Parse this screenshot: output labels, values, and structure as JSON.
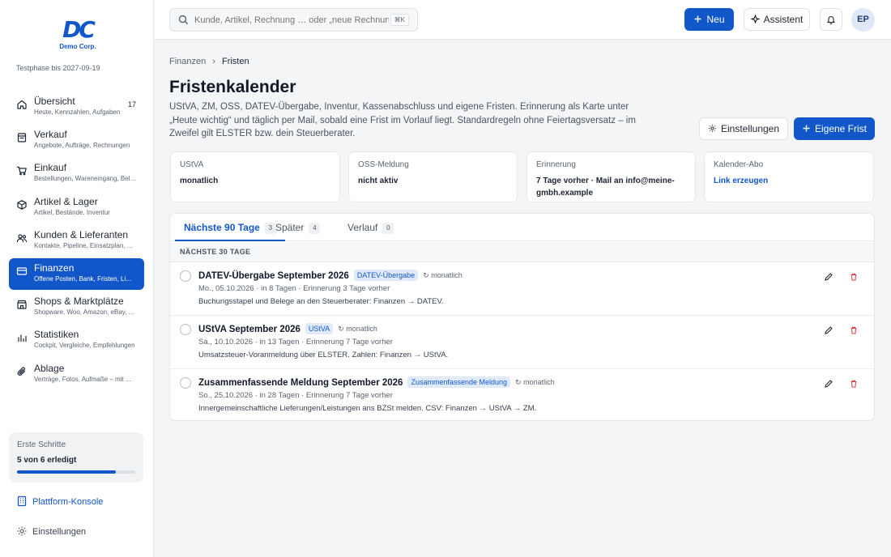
{
  "brand": {
    "logo_text": "DC",
    "company": "Demo Corp.",
    "trial": "Testphase bis 2027-09-19"
  },
  "sidebar": {
    "items": [
      {
        "icon": "home-icon",
        "title": "Übersicht",
        "sub": "Heute, Kennzahlen, Aufgaben",
        "badge": "17",
        "active": false
      },
      {
        "icon": "receipt-icon",
        "title": "Verkauf",
        "sub": "Angebote, Aufträge, Rechnungen",
        "badge": "",
        "active": false
      },
      {
        "icon": "cart-icon",
        "title": "Einkauf",
        "sub": "Bestellungen, Wareneingang, Belege",
        "badge": "",
        "active": false
      },
      {
        "icon": "box-icon",
        "title": "Artikel & Lager",
        "sub": "Artikel, Bestände, Inventur",
        "badge": "",
        "active": false
      },
      {
        "icon": "users-icon",
        "title": "Kunden & Lieferanten",
        "sub": "Kontakte, Pipeline, Einsatzplan, ...",
        "badge": "",
        "active": false
      },
      {
        "icon": "wallet-icon",
        "title": "Finanzen",
        "sub": "Offene Posten, Bank, Fristen, Li...",
        "badge": "",
        "active": true
      },
      {
        "icon": "shop-icon",
        "title": "Shops & Marktplätze",
        "sub": "Shopware, Woo, Amazon, eBay, ...",
        "badge": "",
        "active": false
      },
      {
        "icon": "chart-icon",
        "title": "Statistiken",
        "sub": "Cockpit, Vergleiche, Empfehlungen",
        "badge": "",
        "active": false
      },
      {
        "icon": "paperclip-icon",
        "title": "Ablage",
        "sub": "Verträge, Fotos, Aufmaße – mit ...",
        "badge": "",
        "active": false
      }
    ],
    "steps": {
      "title": "Erste Schritte",
      "value": "5 von 6 erledigt",
      "progress": 0.833
    },
    "platform_label": "Plattform-Konsole",
    "settings_label": "Einstellungen"
  },
  "topbar": {
    "search_placeholder": "Kunde, Artikel, Rechnung … oder „neue Rechnung“",
    "search_kbd": "⌘K",
    "new_label": "Neu",
    "assistant_label": "Assistent",
    "avatar_initials": "EP"
  },
  "page": {
    "crumb_parent": "Finanzen",
    "crumb_sep": "›",
    "crumb_current": "Fristen",
    "title": "Fristenkalender",
    "description": "UStVA, ZM, OSS, DATEV-Übergabe, Inventur, Kassenabschluss und eigene Fristen. Erinnerung als Karte unter „Heute wichtig“ und täglich per Mail, sobald eine Frist im Vorlauf liegt. Standardregeln ohne Feiertagsversatz – im Zweifel gilt ELSTER bzw. dein Steuerberater.",
    "settings_button": "Einstellungen",
    "add_button": "Eigene Frist"
  },
  "info_cards": [
    {
      "label": "UStVA",
      "value": "monatlich",
      "link": false
    },
    {
      "label": "OSS-Meldung",
      "value": "nicht aktiv",
      "link": false
    },
    {
      "label": "Erinnerung",
      "value": "7 Tage vorher · Mail an info@meine-gmbh.example",
      "link": false
    },
    {
      "label": "Kalender-Abo",
      "value": "Link erzeugen",
      "link": true
    }
  ],
  "tabs": [
    {
      "label": "Nächste 90 Tage",
      "count": "3",
      "active": true
    },
    {
      "label": "Später",
      "count": "4",
      "active": false
    },
    {
      "label": "Verlauf",
      "count": "0",
      "active": false
    }
  ],
  "section_label": "NÄCHSTE 30 TAGE",
  "deadlines": [
    {
      "title": "DATEV-Übergabe September 2026",
      "tag": "DATEV-Übergabe",
      "recurrence": "↻ monatlich",
      "meta": "Mo., 05.10.2026 · in 8 Tagen · Erinnerung 3 Tage vorher",
      "note": "Buchungsstapel und Belege an den Steuerberater: Finanzen → DATEV."
    },
    {
      "title": "UStVA September 2026",
      "tag": "UStVA",
      "recurrence": "↻ monatlich",
      "meta": "Sa., 10.10.2026 · in 13 Tagen · Erinnerung 7 Tage vorher",
      "note": "Umsatzsteuer-Voranmeldung über ELSTER. Zahlen: Finanzen → UStVA."
    },
    {
      "title": "Zusammenfassende Meldung September 2026",
      "tag": "Zusammenfassende Meldung",
      "recurrence": "↻ monatlich",
      "meta": "So., 25.10.2026 · in 28 Tagen · Erinnerung 7 Tage vorher",
      "note": "Innergemeinschaftliche Lieferungen/Leistungen ans BZSt melden. CSV: Finanzen → UStVA → ZM."
    }
  ],
  "colors": {
    "accent": "#1257c9",
    "danger": "#d64545",
    "text": "#1e2533",
    "muted": "#5b6472"
  }
}
